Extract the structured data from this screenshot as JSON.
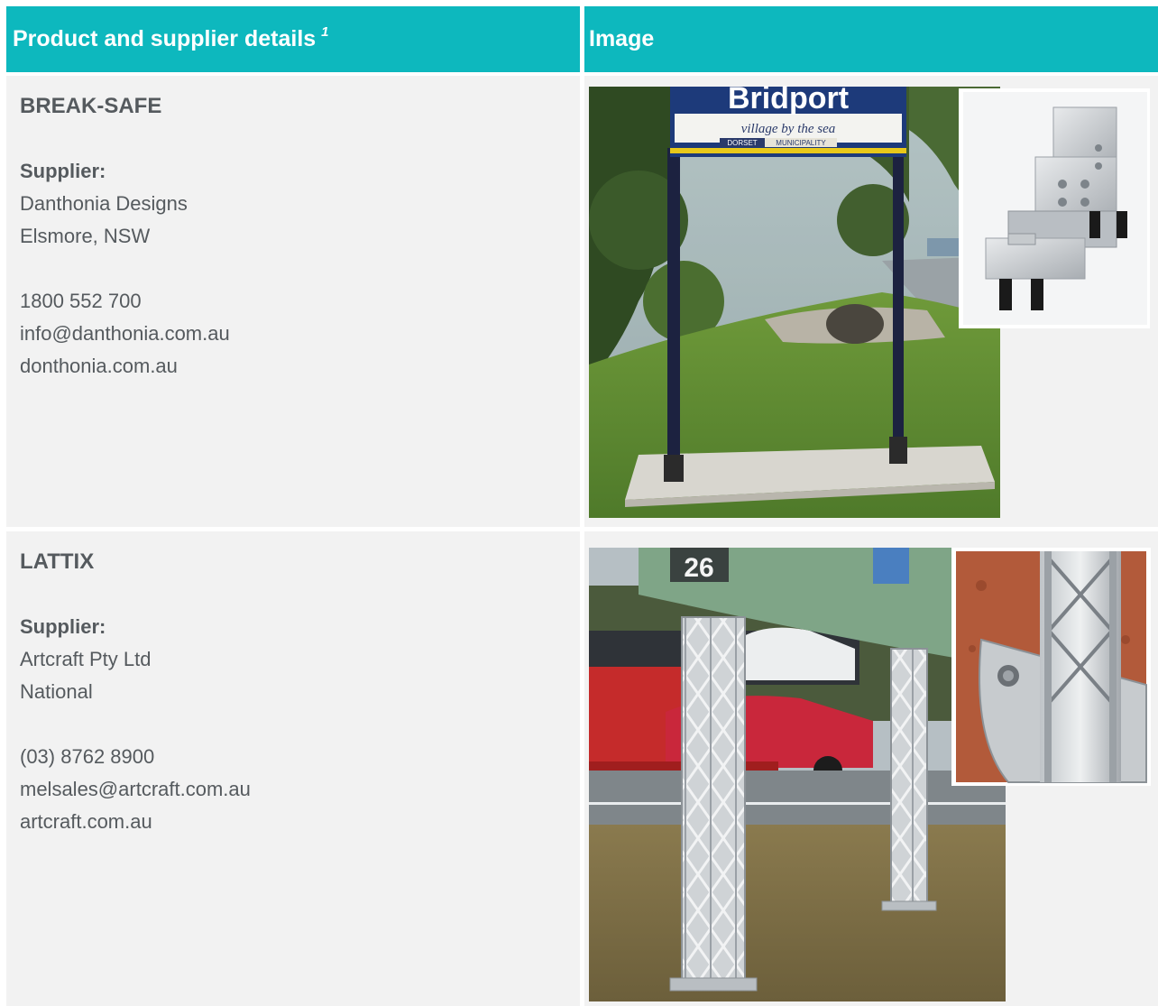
{
  "table": {
    "header": {
      "details_label": "Product and supplier details",
      "details_footnote": "1",
      "image_label": "Image"
    },
    "rows": [
      {
        "product": "BREAK-SAFE",
        "supplier_label": "Supplier:",
        "supplier_name": "Danthonia Designs",
        "location": "Elsmore, NSW",
        "phone": "1800 552 700",
        "email": "info@danthonia.com.au",
        "website": "donthonia.com.au",
        "photo": {
          "sign_title": "Bridport",
          "sign_subtitle": "village by the sea",
          "sign_tag_1": "DORSET",
          "sign_tag_2": "MUNICIPALITY"
        }
      },
      {
        "product": "LATTIX",
        "supplier_label": "Supplier:",
        "supplier_name": "Artcraft Pty Ltd",
        "location": "National",
        "phone": "(03) 8762 8900",
        "email": "melsales@artcraft.com.au",
        "website": "artcraft.com.au",
        "photo": {
          "sign_number": "26"
        }
      }
    ]
  },
  "colors": {
    "header_bg": "#0db8be",
    "cell_bg": "#f2f2f2",
    "text": "#555a5e"
  }
}
